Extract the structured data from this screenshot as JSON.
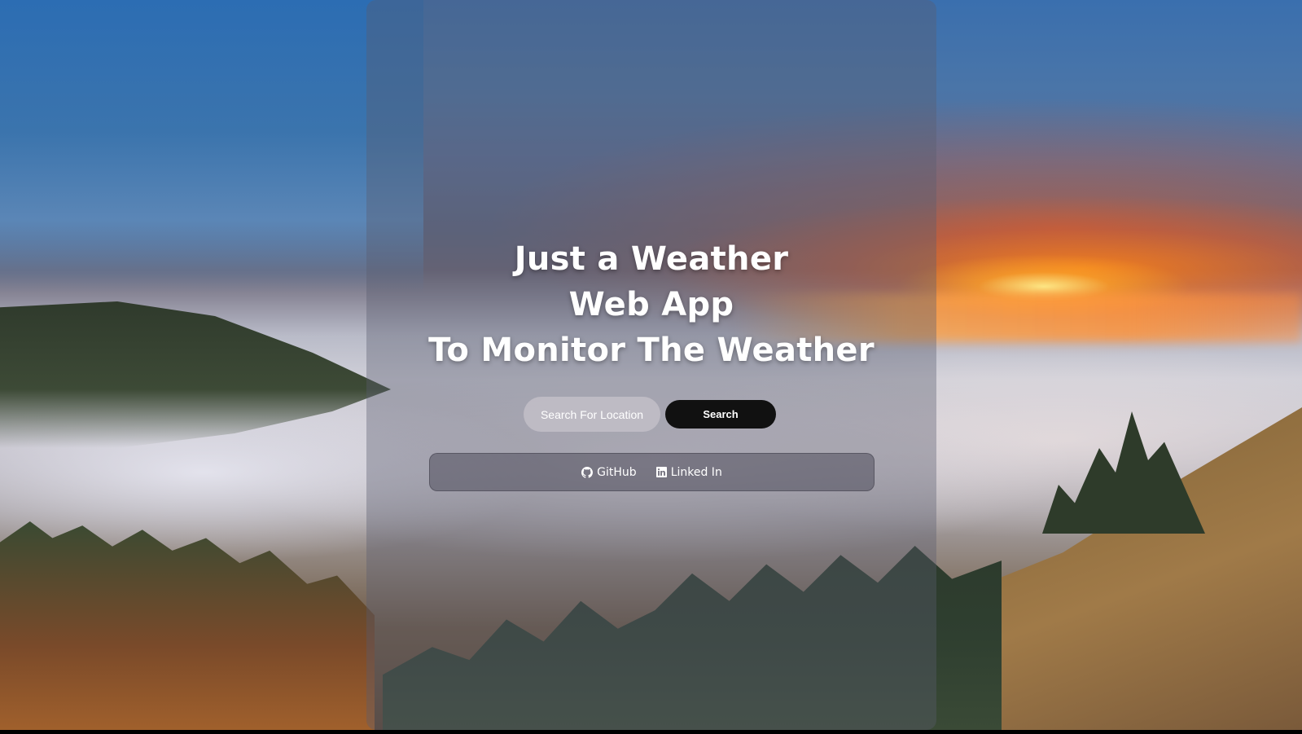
{
  "app": {
    "title_lines": [
      "Just a Weather",
      "Web App",
      "To Monitor The Weather"
    ]
  },
  "search": {
    "placeholder": "Search For Location",
    "value": "",
    "button_label": "Search"
  },
  "links": [
    {
      "label": "GitHub",
      "icon": "github-icon"
    },
    {
      "label": "Linked In",
      "icon": "linkedin-icon"
    }
  ],
  "colors": {
    "button_bg": "#111111",
    "text": "#ffffff",
    "panel_overlay": "rgba(90, 92, 110, 0.38)"
  }
}
